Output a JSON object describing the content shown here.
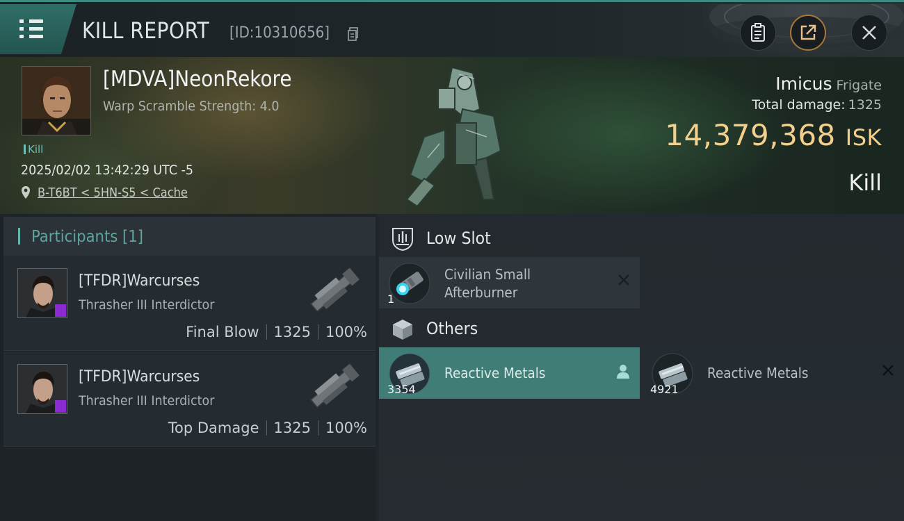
{
  "header": {
    "title": "KILL REPORT",
    "report_id": "[ID:10310656]"
  },
  "victim": {
    "name": "[MDVA]NeonRekore",
    "subtitle": "Warp Scramble Strength: 4.0",
    "tag": "Kill",
    "datetime": "2025/02/02 13:42:29 UTC -5",
    "location": "B-T6BT < 5HN-S5 < Cache",
    "ship_name": "Imicus",
    "ship_class": "Frigate",
    "total_damage_label": "Total damage:",
    "total_damage": "1325",
    "isk_value": "14,379,368",
    "isk_unit": "ISK",
    "result": "Kill"
  },
  "participants": {
    "title": "Participants",
    "count": "[1]",
    "rows": [
      {
        "name": "[TFDR]Warcurses",
        "ship": "Thrasher III Interdictor",
        "role": "Final Blow",
        "damage": "1325",
        "percent": "100%"
      },
      {
        "name": "[TFDR]Warcurses",
        "ship": "Thrasher III Interdictor",
        "role": "Top Damage",
        "damage": "1325",
        "percent": "100%"
      }
    ]
  },
  "items": {
    "low_slot_title": "Low Slot",
    "low_slot": [
      {
        "line1": "Civilian Small",
        "line2": "Afterburner",
        "qty": "1",
        "status": "destroyed"
      }
    ],
    "others_title": "Others",
    "others": [
      {
        "name": "Reactive Metals",
        "qty": "3354",
        "status": "dropped"
      },
      {
        "name": "Reactive Metals",
        "qty": "4921",
        "status": "destroyed"
      }
    ]
  },
  "colors": {
    "accent": "#3f7d76",
    "isk": "#f3cf8e",
    "badge": "#8a2ad0"
  },
  "icons": [
    "menu-icon",
    "copy-icon",
    "clipboard-icon",
    "share-icon",
    "close-icon",
    "location-pin-icon",
    "low-slot-icon",
    "cargo-box-icon",
    "person-icon",
    "x-icon"
  ]
}
